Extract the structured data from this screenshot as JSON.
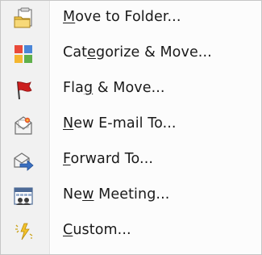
{
  "menu": {
    "items": [
      {
        "icon": "move-to-folder-icon",
        "label_pre": "",
        "mnemonic": "M",
        "label_post": "ove to Folder..."
      },
      {
        "icon": "categorize-icon",
        "label_pre": "Cat",
        "mnemonic": "e",
        "label_post": "gorize & Move..."
      },
      {
        "icon": "flag-icon",
        "label_pre": "Fla",
        "mnemonic": "g",
        "label_post": " & Move..."
      },
      {
        "icon": "new-email-icon",
        "label_pre": "",
        "mnemonic": "N",
        "label_post": "ew E-mail To..."
      },
      {
        "icon": "forward-icon",
        "label_pre": "",
        "mnemonic": "F",
        "label_post": "orward To..."
      },
      {
        "icon": "new-meeting-icon",
        "label_pre": "Ne",
        "mnemonic": "w",
        "label_post": " Meeting..."
      },
      {
        "icon": "custom-icon",
        "label_pre": "",
        "mnemonic": "C",
        "label_post": "ustom..."
      }
    ]
  },
  "colors": {
    "gutter": "#f1f1f1",
    "border": "#c6c6c6",
    "text": "#1a1a1a",
    "flag_red": "#cc1f1f",
    "accent_blue": "#3a6fbf"
  }
}
